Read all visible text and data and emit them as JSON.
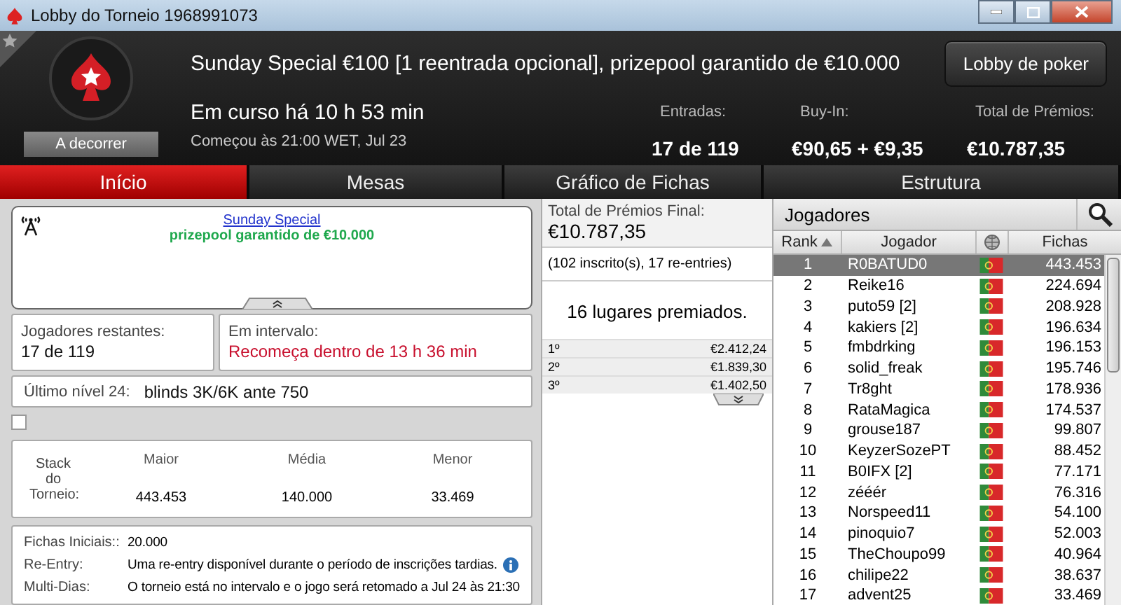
{
  "window": {
    "title": "Lobby do Torneio 1968991073"
  },
  "header": {
    "title": "Sunday Special €100 [1 reentrada opcional], prizepool garantido de €10.000",
    "status": "A decorrer",
    "running": "Em curso há 10 h 53 min",
    "started": "Começou às 21:00 WET, Jul 23",
    "lobby_button": "Lobby de poker",
    "stats": [
      {
        "label": "Entradas:",
        "value": "17 de 119"
      },
      {
        "label": "Buy-In:",
        "value": "€90,65 + €9,35"
      },
      {
        "label": "Total de Prémios:",
        "value": "€10.787,35"
      }
    ]
  },
  "tabs": [
    {
      "label": "Início",
      "selected": true
    },
    {
      "label": "Mesas",
      "selected": false
    },
    {
      "label": "Gráfico de Fichas",
      "selected": false
    },
    {
      "label": "Estrutura",
      "selected": false
    }
  ],
  "news": {
    "link": "Sunday Special",
    "text": "prizepool garantido de €10.000"
  },
  "players_left": {
    "label": "Jogadores restantes:",
    "value": "17 de 119"
  },
  "break": {
    "label": "Em intervalo:",
    "value": "Recomeça dentro de 13 h 36 min"
  },
  "level": {
    "label": "Último nível 24:",
    "value": "blinds 3K/6K ante 750"
  },
  "checkbox": {
    "checked": false
  },
  "stacks": {
    "label": "Stack do Torneio:",
    "columns": [
      {
        "label": "Maior",
        "value": "443.453"
      },
      {
        "label": "Média",
        "value": "140.000"
      },
      {
        "label": "Menor",
        "value": "33.469"
      }
    ]
  },
  "info": [
    {
      "label": "Fichas Iniciais::",
      "value": "20.000",
      "info": false
    },
    {
      "label": "Re-Entry:",
      "value": "Uma re-entry disponível durante o período de inscrições tardias.",
      "info": true
    },
    {
      "label": "Multi-Dias:",
      "value": "O torneio está no intervalo e o jogo será retomado a Jul 24 às 21:30",
      "info": false
    }
  ],
  "prizes": {
    "label": "Total de Prémios Final:",
    "total": "€10.787,35",
    "entries": "(102 inscrito(s), 17 re-entries)",
    "paid": "16 lugares premiados.",
    "places": [
      {
        "place": "1º",
        "amount": "€2.412,24"
      },
      {
        "place": "2º",
        "amount": "€1.839,30"
      },
      {
        "place": "3º",
        "amount": "€1.402,50"
      }
    ]
  },
  "players": {
    "title": "Jogadores",
    "columns": [
      "Rank",
      "Jogador",
      "Fichas"
    ],
    "rows": [
      {
        "rank": "1",
        "name": "R0BATUD0",
        "chips": "443.453",
        "selected": true
      },
      {
        "rank": "2",
        "name": "Reike16",
        "chips": "224.694",
        "selected": false
      },
      {
        "rank": "3",
        "name": "puto59 [2]",
        "chips": "208.928",
        "selected": false
      },
      {
        "rank": "4",
        "name": "kakiers [2]",
        "chips": "196.634",
        "selected": false
      },
      {
        "rank": "5",
        "name": "fmbdrking",
        "chips": "196.153",
        "selected": false
      },
      {
        "rank": "6",
        "name": "solid_freak",
        "chips": "195.746",
        "selected": false
      },
      {
        "rank": "7",
        "name": "Tr8ght",
        "chips": "178.936",
        "selected": false
      },
      {
        "rank": "8",
        "name": "RataMagica",
        "chips": "174.537",
        "selected": false
      },
      {
        "rank": "9",
        "name": "grouse187",
        "chips": "99.807",
        "selected": false
      },
      {
        "rank": "10",
        "name": "KeyzerSozePT",
        "chips": "88.452",
        "selected": false
      },
      {
        "rank": "11",
        "name": "B0IFX [2]",
        "chips": "77.171",
        "selected": false
      },
      {
        "rank": "12",
        "name": "zééér",
        "chips": "76.316",
        "selected": false
      },
      {
        "rank": "13",
        "name": "Norspeed11",
        "chips": "54.100",
        "selected": false
      },
      {
        "rank": "14",
        "name": "pinoquio7",
        "chips": "52.003",
        "selected": false
      },
      {
        "rank": "15",
        "name": "TheChoupo99",
        "chips": "40.964",
        "selected": false
      },
      {
        "rank": "16",
        "name": "chilipe22",
        "chips": "38.637",
        "selected": false
      },
      {
        "rank": "17",
        "name": "advent25",
        "chips": "33.469",
        "selected": false
      }
    ]
  }
}
